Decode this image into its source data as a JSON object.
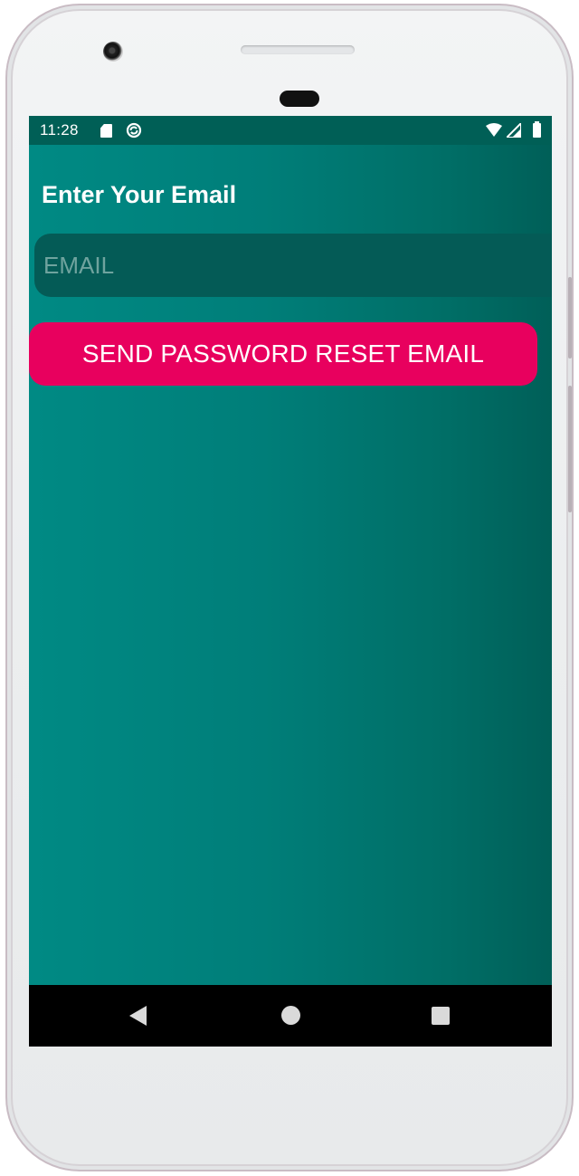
{
  "status_bar": {
    "time": "11:28",
    "icons": [
      "sd-card-icon",
      "sync-icon",
      "wifi-icon",
      "cell-signal-icon",
      "battery-icon"
    ]
  },
  "screen": {
    "title": "Enter Your Email",
    "email_field": {
      "value": "",
      "placeholder": "EMAIL"
    },
    "reset_button_label": "SEND PASSWORD RESET EMAIL"
  },
  "nav_bar": {
    "icons": [
      "back-icon",
      "home-icon",
      "recents-icon"
    ]
  },
  "colors": {
    "status_bar": "#005f56",
    "background_left": "#008a84",
    "background_right": "#005f58",
    "input_background": "#045b56",
    "button": "#e8005e",
    "nav_bar": "#000000"
  }
}
